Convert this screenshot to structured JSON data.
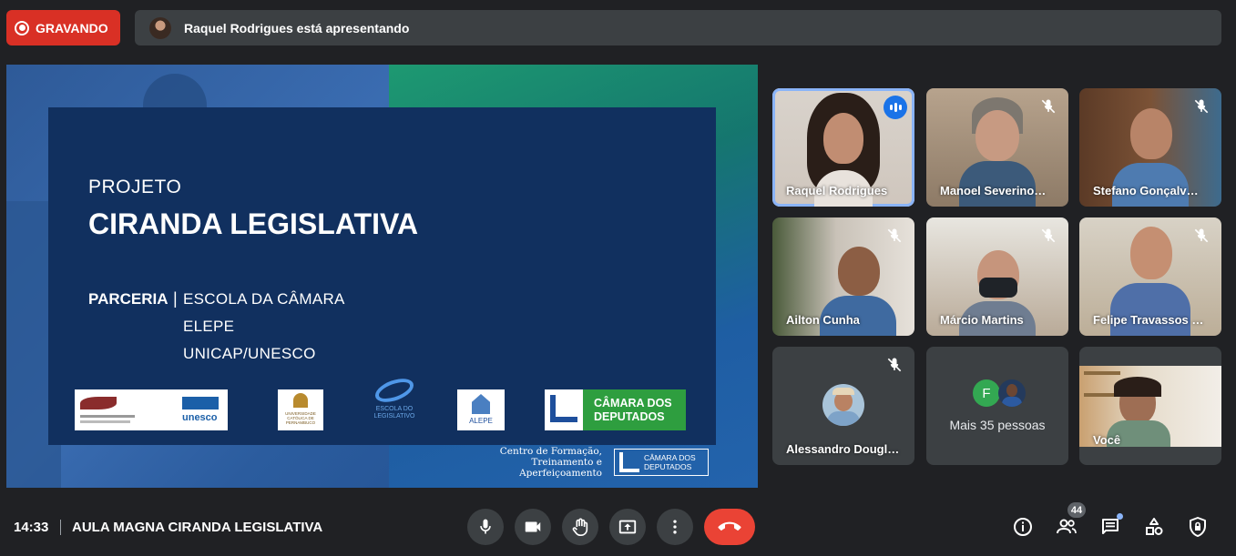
{
  "recording": {
    "label": "GRAVANDO"
  },
  "presenting": {
    "text": "Raquel Rodrigues está apresentando"
  },
  "slide": {
    "projeto": "PROJETO",
    "title": "CIRANDA LEGISLATIVA",
    "parceria_label": "PARCERIA",
    "separator": "|",
    "partners": [
      "ESCOLA DA CÂMARA",
      "ELEPE",
      "UNICAP/UNESCO"
    ],
    "logos": {
      "unesco": "unesco",
      "catolica": "UNIVERSIDADE CATÓLICA DE PERNAMBUCO",
      "escola": "ESCOLA DO LEGISLATIVO",
      "alepe": "ALEPE",
      "camara": "CÂMARA DOS DEPUTADOS"
    },
    "footer_text": "Centro de Formação, Treinamento e Aperfeiçoamento",
    "footer_logo": "CÂMARA DOS DEPUTADOS"
  },
  "participants": [
    {
      "name": "Raquel Rodrigues",
      "state": "speaking"
    },
    {
      "name": "Manoel Severino…",
      "state": "muted"
    },
    {
      "name": "Stefano Gonçalv…",
      "state": "muted"
    },
    {
      "name": "Ailton Cunha",
      "state": "muted"
    },
    {
      "name": "Márcio Martins",
      "state": "muted"
    },
    {
      "name": "Felipe Travassos …",
      "state": "muted"
    },
    {
      "name": "Alessandro Dougl…",
      "state": "muted"
    },
    {
      "name": "Você",
      "state": "self"
    }
  ],
  "more_people": {
    "label": "Mais 35 pessoas",
    "initial": "F"
  },
  "bottom": {
    "time": "14:33",
    "meeting_title": "AULA MAGNA CIRANDA LEGISLATIVA",
    "people_count": "44"
  },
  "colors": {
    "record": "#d93025",
    "hangup": "#ea4335",
    "speaking": "#1a73e8",
    "camara_green": "#2e9e3f"
  }
}
